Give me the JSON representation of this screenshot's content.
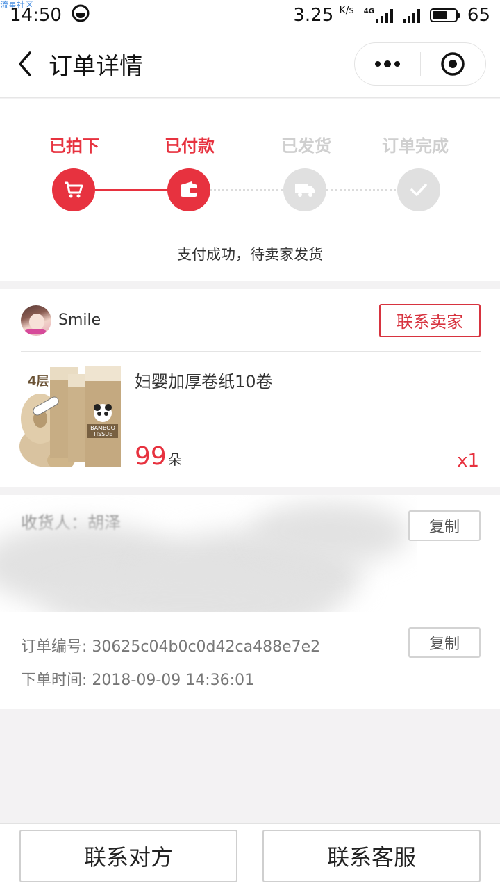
{
  "watermark": "流星社区",
  "status_bar": {
    "time": "14:50",
    "net_speed": "3.25",
    "net_unit": "K/s",
    "network_type": "4G",
    "battery": "65"
  },
  "nav": {
    "title": "订单详情"
  },
  "progress": {
    "steps": [
      {
        "label": "已拍下",
        "icon": "cart-icon",
        "state": "active"
      },
      {
        "label": "已付款",
        "icon": "wallet-icon",
        "state": "active"
      },
      {
        "label": "已发货",
        "icon": "truck-icon",
        "state": "inactive"
      },
      {
        "label": "订单完成",
        "icon": "check-icon",
        "state": "inactive"
      }
    ],
    "status_text": "支付成功，待卖家发货"
  },
  "seller": {
    "name": "Smile",
    "contact_label": "联系卖家"
  },
  "product": {
    "name": "妇婴加厚卷纸10卷",
    "price": "99",
    "price_unit": "朵",
    "quantity": "x1",
    "image_text": {
      "layers": "4层",
      "brand_line1": "BAMBOO",
      "brand_line2": "TISSUE"
    }
  },
  "address": {
    "recipient_partial": "收货人：胡泽",
    "copy_label": "复制"
  },
  "order": {
    "number_label": "订单编号:",
    "number": "30625c04b0c0d42ca488e7e2",
    "time_label": "下单时间:",
    "time": "2018-09-09 14:36:01",
    "copy_label": "复制"
  },
  "bottom": {
    "contact_other": "联系对方",
    "contact_service": "联系客服"
  },
  "colors": {
    "accent": "#e7323f",
    "inactive": "#e0e0e0",
    "background": "#f3f2f3"
  }
}
